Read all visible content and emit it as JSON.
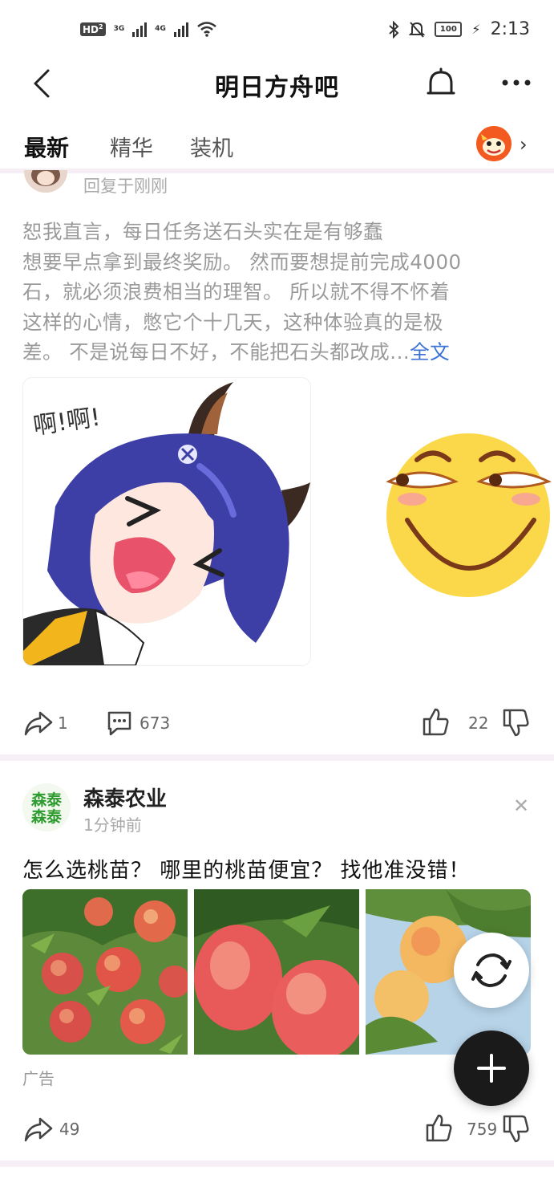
{
  "status_bar": {
    "hd_badge": "HD",
    "hd_sub": "2",
    "net1": "3G",
    "net2": "4G",
    "battery": "100",
    "time": "2:13"
  },
  "nav": {
    "title": "明日方舟吧",
    "back_icon": "chevron-left-icon",
    "bell_icon": "bell-icon",
    "more_icon": "more-icon"
  },
  "tabs": [
    {
      "label": "最新",
      "active": true
    },
    {
      "label": "精华",
      "active": false
    },
    {
      "label": "装机",
      "active": false
    }
  ],
  "post1": {
    "reply_label": "回复于刚刚",
    "text_lines": [
      "恕我直言，每日任务送石头实在是有够蠢",
      "想要早点拿到最终奖励。 然而要想提前完成4000",
      "石，就必须浪费相当的理智。 所以就不得不怀着",
      "这样的心情，憋它个十几天，这种体验真的是极",
      "差。 不是说每日不好，不能把石头都改成..."
    ],
    "more_link": "全文",
    "sticker_text": "啊!啊!",
    "share_count": "1",
    "comment_count": "673",
    "like_count": "22"
  },
  "ad_post": {
    "author": "森泰农业",
    "logo_text_top": "森泰",
    "logo_text_bottom": "森泰",
    "time": "1分钟前",
    "text": "怎么选桃苗？ 哪里的桃苗便宜？ 找他准没错！",
    "ad_label": "广告",
    "share_count": "49",
    "like_count": "759"
  },
  "colors": {
    "accent_link": "#3a73d3",
    "divider": "#f6eff5",
    "fab_dark": "#1a1a1a",
    "emoji_yellow": "#fbd84a"
  }
}
